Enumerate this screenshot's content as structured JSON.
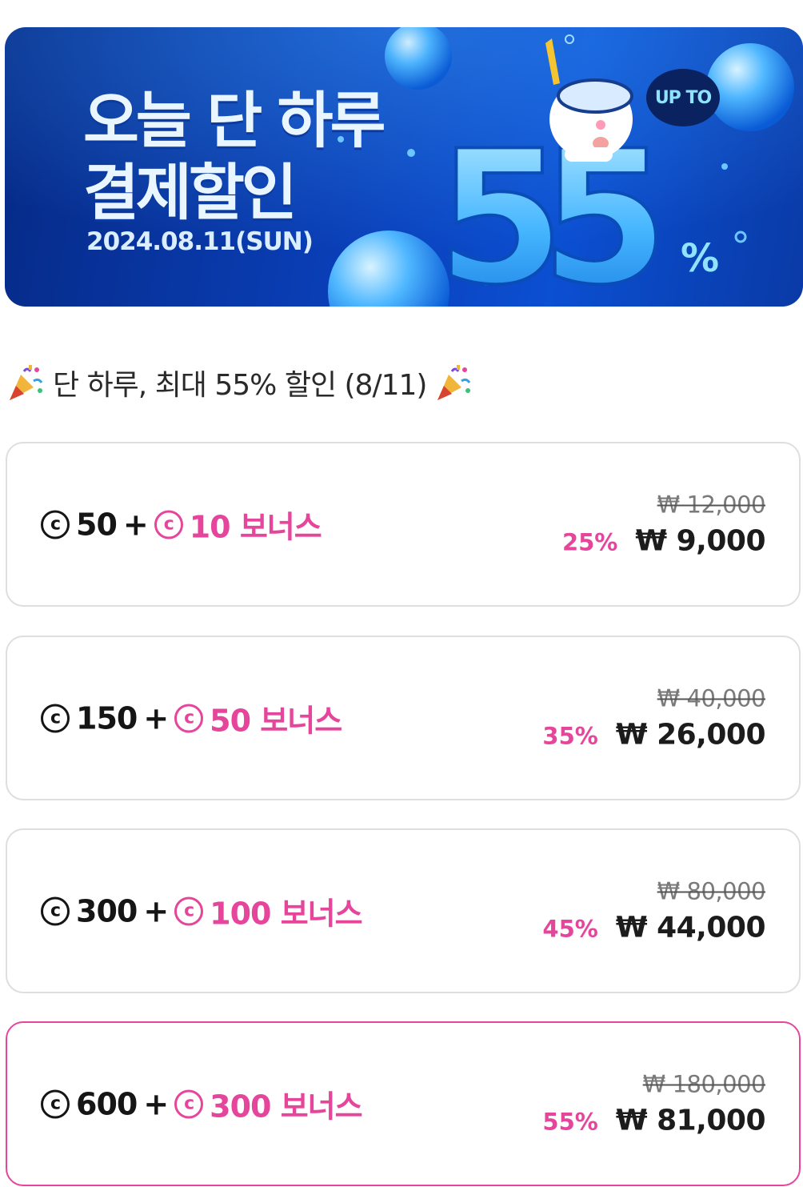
{
  "banner": {
    "title_line1": "오늘 단 하루",
    "title_line2": "결제할인",
    "date": "2024.08.11(SUN)",
    "badge": "UP TO",
    "big_number": "55",
    "percent_sign": "%",
    "colors": {
      "bg_dark": "#062a86",
      "bg_light": "#0b4fd2",
      "bubble": "#4fb7ff"
    }
  },
  "heading": {
    "text": "단 하루, 최대 55% 할인 (8/11)",
    "icon": "party-popper-icon"
  },
  "offers": [
    {
      "coins": "50",
      "bonus": "10 보너스",
      "original": "₩ 12,000",
      "discount": "25%",
      "price": "₩ 9,000",
      "selected": false
    },
    {
      "coins": "150",
      "bonus": "50 보너스",
      "original": "₩ 40,000",
      "discount": "35%",
      "price": "₩ 26,000",
      "selected": false
    },
    {
      "coins": "300",
      "bonus": "100 보너스",
      "original": "₩ 80,000",
      "discount": "45%",
      "price": "₩ 44,000",
      "selected": false
    },
    {
      "coins": "600",
      "bonus": "300 보너스",
      "original": "₩ 180,000",
      "discount": "55%",
      "price": "₩ 81,000",
      "selected": true
    }
  ],
  "symbols": {
    "coin": "c",
    "plus": "+"
  },
  "colors": {
    "accent": "#e5469c",
    "border": "#dedede",
    "text": "#151515",
    "muted": "#7a7a7a"
  }
}
